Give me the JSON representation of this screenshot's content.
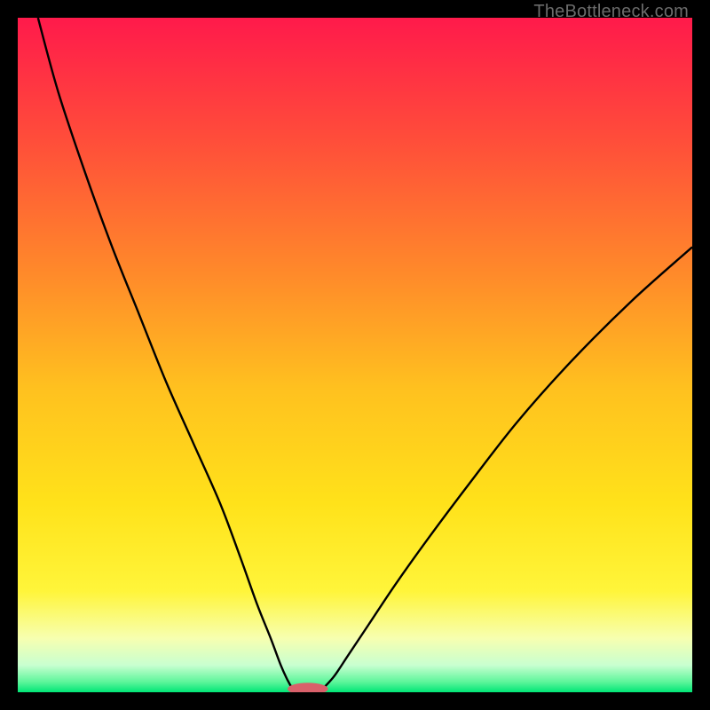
{
  "watermark": "TheBottleneck.com",
  "chart_data": {
    "type": "line",
    "title": "",
    "xlabel": "",
    "ylabel": "",
    "xlim": [
      0,
      100
    ],
    "ylim": [
      0,
      100
    ],
    "grid": false,
    "legend": false,
    "background_gradient": {
      "stops": [
        {
          "offset": 0.0,
          "color": "#ff1a4b"
        },
        {
          "offset": 0.18,
          "color": "#ff4d3a"
        },
        {
          "offset": 0.38,
          "color": "#ff8a2a"
        },
        {
          "offset": 0.55,
          "color": "#ffc11f"
        },
        {
          "offset": 0.72,
          "color": "#ffe21a"
        },
        {
          "offset": 0.85,
          "color": "#fff53a"
        },
        {
          "offset": 0.92,
          "color": "#f7ffb0"
        },
        {
          "offset": 0.96,
          "color": "#c8ffd0"
        },
        {
          "offset": 0.985,
          "color": "#5cf59a"
        },
        {
          "offset": 1.0,
          "color": "#00e676"
        }
      ]
    },
    "series": [
      {
        "name": "left-branch",
        "x": [
          3,
          6,
          10,
          14,
          18,
          22,
          26,
          30,
          33,
          35.5,
          37.5,
          39,
          40,
          40.7,
          41.2
        ],
        "y": [
          100,
          89,
          77,
          66,
          56,
          46,
          37,
          28,
          20,
          13,
          8,
          4,
          1.8,
          0.6,
          0.1
        ]
      },
      {
        "name": "right-branch",
        "x": [
          44.8,
          45.5,
          47,
          49,
          52,
          56,
          61,
          67,
          74,
          82,
          91,
          100
        ],
        "y": [
          0.1,
          0.8,
          2.5,
          5.5,
          10,
          16,
          23,
          31,
          40,
          49,
          58,
          66
        ]
      }
    ],
    "marker": {
      "name": "optimum-marker",
      "cx": 43,
      "cy": 0.5,
      "rx": 3.0,
      "ry": 0.9,
      "fill": "#d9606a"
    }
  }
}
